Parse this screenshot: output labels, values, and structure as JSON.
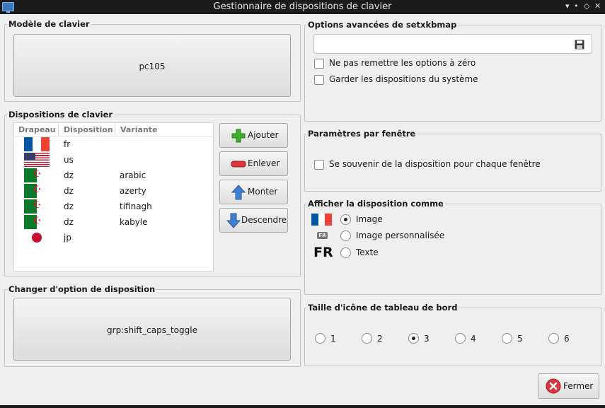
{
  "window": {
    "title": "Gestionnaire de dispositions de clavier"
  },
  "model_group": {
    "title": "Modèle de clavier",
    "button_label": "pc105"
  },
  "layouts_group": {
    "title": "Dispositions de clavier",
    "columns": [
      "Drapeau",
      "Disposition",
      "Variante"
    ],
    "rows": [
      {
        "flag": "france-flag-icon",
        "layout": "fr",
        "variant": ""
      },
      {
        "flag": "usa-flag-icon",
        "layout": "us",
        "variant": ""
      },
      {
        "flag": "algeria-flag-icon",
        "layout": "dz",
        "variant": "arabic"
      },
      {
        "flag": "algeria-flag-icon",
        "layout": "dz",
        "variant": "azerty"
      },
      {
        "flag": "algeria-flag-icon",
        "layout": "dz",
        "variant": "tifinagh"
      },
      {
        "flag": "algeria-flag-icon",
        "layout": "dz",
        "variant": "kabyle"
      },
      {
        "flag": "japan-flag-icon",
        "layout": "jp",
        "variant": ""
      }
    ],
    "buttons": {
      "add": "Ajouter",
      "remove": "Enlever",
      "up": "Monter",
      "down": "Descendre"
    }
  },
  "switch_group": {
    "title": "Changer d'option de disposition",
    "button_label": "grp:shift_caps_toggle"
  },
  "setxkbmap_group": {
    "title": "Options avancées de setxkbmap",
    "input_value": "",
    "option_reset": "Ne pas remettre les options à zéro",
    "option_keep": "Garder les dispositions du système",
    "option_reset_checked": false,
    "option_keep_checked": false
  },
  "per_window_group": {
    "title": "Paramètres par fenêtre",
    "remember_label": "Se souvenir de la disposition pour chaque fenêtre",
    "remember_checked": false
  },
  "display_group": {
    "title": "Afficher la disposition comme",
    "options": [
      "Image",
      "Image personnalisée",
      "Texte"
    ],
    "selected": "Image",
    "custom_badge": "FR",
    "text_preview": "FR"
  },
  "icon_size_group": {
    "title": "Taille d'icône de tableau de bord",
    "options": [
      "1",
      "2",
      "3",
      "4",
      "5",
      "6"
    ],
    "selected": "3"
  },
  "footer": {
    "close_label": "Fermer"
  },
  "colors": {
    "titlebar": "#1b1b1b",
    "window_bg": "#efefef",
    "add_green": "#3fae2a",
    "remove_red": "#d9363e",
    "arrow_blue": "#3f7fd0"
  }
}
